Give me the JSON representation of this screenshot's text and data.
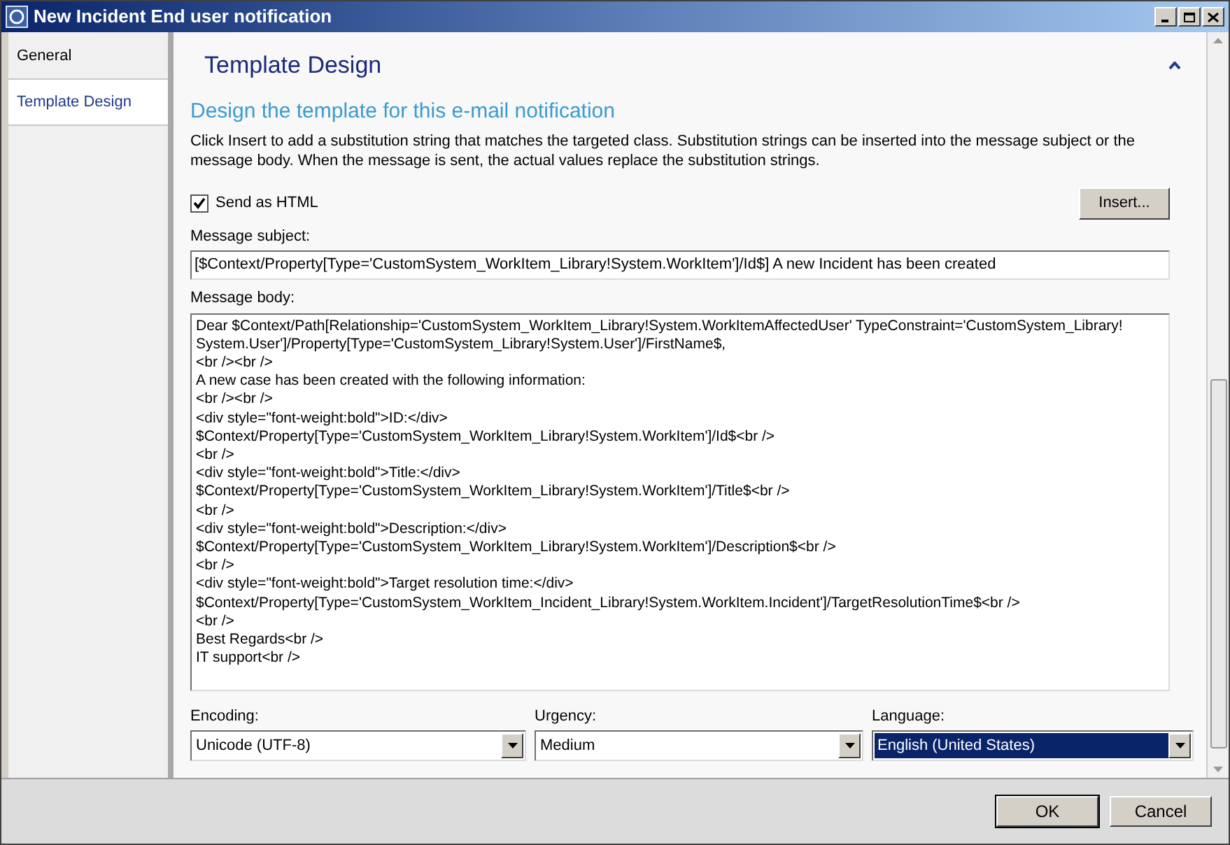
{
  "window": {
    "title": "New Incident End user notification"
  },
  "sidebar": {
    "items": [
      {
        "label": "General",
        "selected": false
      },
      {
        "label": "Template Design",
        "selected": true
      }
    ]
  },
  "section": {
    "title": "Template Design",
    "expanded": true
  },
  "heading": "Design the template for this e-mail notification",
  "description": "Click Insert to add a substitution string that matches the targeted class. Substitution strings can be inserted into the message subject or the message body. When the message is sent, the actual values replace the substitution strings.",
  "send_as_html": {
    "label": "Send as HTML",
    "checked": true
  },
  "insert_button": "Insert...",
  "subject": {
    "label": "Message subject:",
    "value": "[$Context/Property[Type='CustomSystem_WorkItem_Library!System.WorkItem']/Id$] A new Incident has been created"
  },
  "body": {
    "label": "Message body:",
    "lines": [
      "Dear $Context/Path[Relationship='CustomSystem_WorkItem_Library!System.WorkItemAffectedUser' TypeConstraint='CustomSystem_Library!",
      "System.User']/Property[Type='CustomSystem_Library!System.User']/FirstName$,",
      "<br /><br />",
      "A new case has been created with the following information:",
      "<br /><br />",
      "<div style=\"font-weight:bold\">ID:</div>",
      "$Context/Property[Type='CustomSystem_WorkItem_Library!System.WorkItem']/Id$<br />",
      "<br />",
      "<div style=\"font-weight:bold\">Title:</div>",
      "$Context/Property[Type='CustomSystem_WorkItem_Library!System.WorkItem']/Title$<br />",
      "<br />",
      "<div style=\"font-weight:bold\">Description:</div>",
      "$Context/Property[Type='CustomSystem_WorkItem_Library!System.WorkItem']/Description$<br />",
      "<br />",
      "<div style=\"font-weight:bold\">Target resolution time:</div>",
      "$Context/Property[Type='CustomSystem_WorkItem_Incident_Library!System.WorkItem.Incident']/TargetResolutionTime$<br />",
      "<br />",
      "Best Regards<br />",
      "IT support<br />"
    ]
  },
  "dropdowns": [
    {
      "label": "Encoding:",
      "value": "Unicode (UTF-8)",
      "selected": false
    },
    {
      "label": "Urgency:",
      "value": "Medium",
      "selected": false
    },
    {
      "label": "Language:",
      "value": "English (United States)",
      "selected": true
    }
  ],
  "buttons": [
    "OK",
    "Cancel"
  ]
}
